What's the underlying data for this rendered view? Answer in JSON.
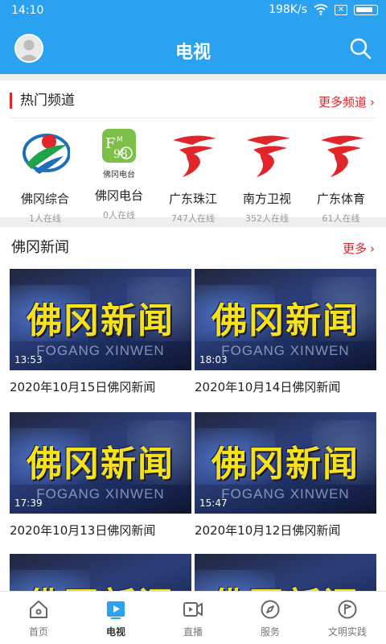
{
  "status": {
    "time": "14:10",
    "speed": "198K/s"
  },
  "header": {
    "title": "电视"
  },
  "hot": {
    "title": "热门频道",
    "more": "更多频道",
    "channels": [
      {
        "name": "佛冈综合",
        "count": "1人在线",
        "logo_caption": ""
      },
      {
        "name": "佛冈电台",
        "count": "0人在线",
        "logo_caption": "佛冈电台"
      },
      {
        "name": "广东珠江",
        "count": "747人在线",
        "logo_caption": ""
      },
      {
        "name": "南方卫视",
        "count": "352人在线",
        "logo_caption": ""
      },
      {
        "name": "广东体育",
        "count": "61人在线",
        "logo_caption": ""
      }
    ]
  },
  "news": {
    "title": "佛冈新闻",
    "more": "更多",
    "thumb_big": "佛冈新闻",
    "thumb_sub": "FOGANG XINWEN",
    "videos": [
      {
        "duration": "13:53",
        "title": "2020年10月15日佛冈新闻"
      },
      {
        "duration": "18:03",
        "title": "2020年10月14日佛冈新闻"
      },
      {
        "duration": "17:39",
        "title": "2020年10月13日佛冈新闻"
      },
      {
        "duration": "15:47",
        "title": "2020年10月12日佛冈新闻"
      }
    ]
  },
  "tabs": [
    {
      "label": "首页",
      "icon": "home-icon"
    },
    {
      "label": "电视",
      "icon": "tv-play-icon"
    },
    {
      "label": "直播",
      "icon": "video-camera-icon"
    },
    {
      "label": "服务",
      "icon": "compass-icon"
    },
    {
      "label": "文明实践",
      "icon": "flag-icon"
    }
  ],
  "colors": {
    "primary": "#2aa2ef",
    "accent": "#e0262a"
  }
}
